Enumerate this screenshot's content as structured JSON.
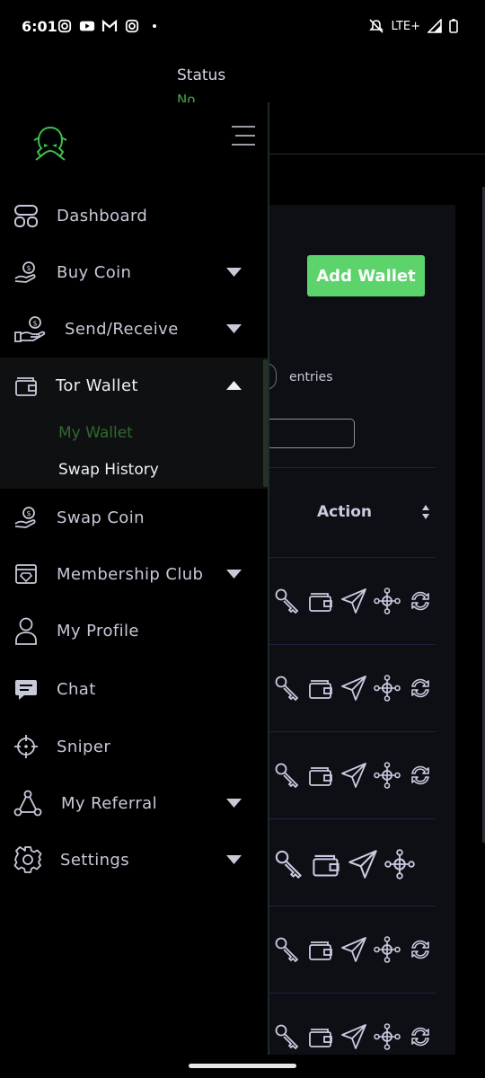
{
  "status_bar": {
    "time": "6:01",
    "network": "LTE+",
    "left_icons": [
      "instagram-icon",
      "youtube-icon",
      "gmail-icon",
      "instagram-icon",
      "dot-icon"
    ],
    "right_icons": [
      "mute-icon",
      "signal-icon",
      "battery-icon"
    ]
  },
  "background": {
    "status_label": "Status",
    "status_value": "No",
    "add_wallet_label": "Add Wallet",
    "entries_label": "entries",
    "table": {
      "action_header": "Action",
      "row_icons": [
        "key-icon",
        "wallet-icon",
        "send-icon",
        "network-icon",
        "swap-icon"
      ],
      "rows": 6
    },
    "colors": {
      "accent": "#5cd36b",
      "card": "#0e0f14"
    }
  },
  "drawer": {
    "logo": "logo-icon",
    "menu_toggle": "hamburger-icon",
    "items": [
      {
        "label": "Dashboard",
        "icon": "dashboard-icon",
        "caret": "none"
      },
      {
        "label": "Buy Coin",
        "icon": "buy-coin-icon",
        "caret": "down"
      },
      {
        "label": "Send/Receive",
        "icon": "send-receive-icon",
        "caret": "down"
      },
      {
        "label": "Tor Wallet",
        "icon": "wallet-icon",
        "caret": "up"
      },
      {
        "label": "Swap Coin",
        "icon": "swap-coin-icon",
        "caret": "none"
      },
      {
        "label": "Membership Club",
        "icon": "membership-icon",
        "caret": "down"
      },
      {
        "label": "My Profile",
        "icon": "profile-icon",
        "caret": "none"
      },
      {
        "label": "Chat",
        "icon": "chat-icon",
        "caret": "none"
      },
      {
        "label": "Sniper",
        "icon": "crosshair-icon",
        "caret": "none"
      },
      {
        "label": "My Referral",
        "icon": "referral-icon",
        "caret": "down"
      },
      {
        "label": "Settings",
        "icon": "gear-icon",
        "caret": "down"
      }
    ],
    "tor_wallet_sub": [
      "My Wallet",
      "Swap History"
    ],
    "active_sub": "My Wallet",
    "colors": {
      "active": "#2f6930",
      "text": "#c7c9d9"
    }
  }
}
